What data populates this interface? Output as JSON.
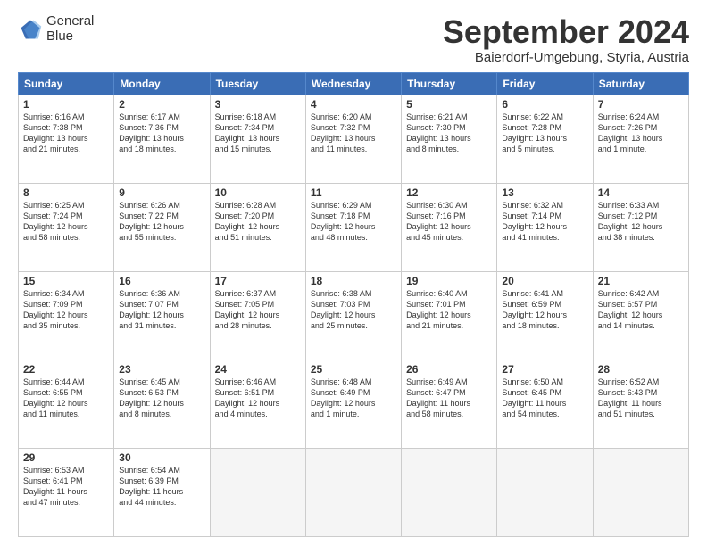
{
  "header": {
    "logo_line1": "General",
    "logo_line2": "Blue",
    "month": "September 2024",
    "location": "Baierdorf-Umgebung, Styria, Austria"
  },
  "weekdays": [
    "Sunday",
    "Monday",
    "Tuesday",
    "Wednesday",
    "Thursday",
    "Friday",
    "Saturday"
  ],
  "weeks": [
    [
      {
        "day": "1",
        "lines": [
          "Sunrise: 6:16 AM",
          "Sunset: 7:38 PM",
          "Daylight: 13 hours",
          "and 21 minutes."
        ]
      },
      {
        "day": "2",
        "lines": [
          "Sunrise: 6:17 AM",
          "Sunset: 7:36 PM",
          "Daylight: 13 hours",
          "and 18 minutes."
        ]
      },
      {
        "day": "3",
        "lines": [
          "Sunrise: 6:18 AM",
          "Sunset: 7:34 PM",
          "Daylight: 13 hours",
          "and 15 minutes."
        ]
      },
      {
        "day": "4",
        "lines": [
          "Sunrise: 6:20 AM",
          "Sunset: 7:32 PM",
          "Daylight: 13 hours",
          "and 11 minutes."
        ]
      },
      {
        "day": "5",
        "lines": [
          "Sunrise: 6:21 AM",
          "Sunset: 7:30 PM",
          "Daylight: 13 hours",
          "and 8 minutes."
        ]
      },
      {
        "day": "6",
        "lines": [
          "Sunrise: 6:22 AM",
          "Sunset: 7:28 PM",
          "Daylight: 13 hours",
          "and 5 minutes."
        ]
      },
      {
        "day": "7",
        "lines": [
          "Sunrise: 6:24 AM",
          "Sunset: 7:26 PM",
          "Daylight: 13 hours",
          "and 1 minute."
        ]
      }
    ],
    [
      {
        "day": "8",
        "lines": [
          "Sunrise: 6:25 AM",
          "Sunset: 7:24 PM",
          "Daylight: 12 hours",
          "and 58 minutes."
        ]
      },
      {
        "day": "9",
        "lines": [
          "Sunrise: 6:26 AM",
          "Sunset: 7:22 PM",
          "Daylight: 12 hours",
          "and 55 minutes."
        ]
      },
      {
        "day": "10",
        "lines": [
          "Sunrise: 6:28 AM",
          "Sunset: 7:20 PM",
          "Daylight: 12 hours",
          "and 51 minutes."
        ]
      },
      {
        "day": "11",
        "lines": [
          "Sunrise: 6:29 AM",
          "Sunset: 7:18 PM",
          "Daylight: 12 hours",
          "and 48 minutes."
        ]
      },
      {
        "day": "12",
        "lines": [
          "Sunrise: 6:30 AM",
          "Sunset: 7:16 PM",
          "Daylight: 12 hours",
          "and 45 minutes."
        ]
      },
      {
        "day": "13",
        "lines": [
          "Sunrise: 6:32 AM",
          "Sunset: 7:14 PM",
          "Daylight: 12 hours",
          "and 41 minutes."
        ]
      },
      {
        "day": "14",
        "lines": [
          "Sunrise: 6:33 AM",
          "Sunset: 7:12 PM",
          "Daylight: 12 hours",
          "and 38 minutes."
        ]
      }
    ],
    [
      {
        "day": "15",
        "lines": [
          "Sunrise: 6:34 AM",
          "Sunset: 7:09 PM",
          "Daylight: 12 hours",
          "and 35 minutes."
        ]
      },
      {
        "day": "16",
        "lines": [
          "Sunrise: 6:36 AM",
          "Sunset: 7:07 PM",
          "Daylight: 12 hours",
          "and 31 minutes."
        ]
      },
      {
        "day": "17",
        "lines": [
          "Sunrise: 6:37 AM",
          "Sunset: 7:05 PM",
          "Daylight: 12 hours",
          "and 28 minutes."
        ]
      },
      {
        "day": "18",
        "lines": [
          "Sunrise: 6:38 AM",
          "Sunset: 7:03 PM",
          "Daylight: 12 hours",
          "and 25 minutes."
        ]
      },
      {
        "day": "19",
        "lines": [
          "Sunrise: 6:40 AM",
          "Sunset: 7:01 PM",
          "Daylight: 12 hours",
          "and 21 minutes."
        ]
      },
      {
        "day": "20",
        "lines": [
          "Sunrise: 6:41 AM",
          "Sunset: 6:59 PM",
          "Daylight: 12 hours",
          "and 18 minutes."
        ]
      },
      {
        "day": "21",
        "lines": [
          "Sunrise: 6:42 AM",
          "Sunset: 6:57 PM",
          "Daylight: 12 hours",
          "and 14 minutes."
        ]
      }
    ],
    [
      {
        "day": "22",
        "lines": [
          "Sunrise: 6:44 AM",
          "Sunset: 6:55 PM",
          "Daylight: 12 hours",
          "and 11 minutes."
        ]
      },
      {
        "day": "23",
        "lines": [
          "Sunrise: 6:45 AM",
          "Sunset: 6:53 PM",
          "Daylight: 12 hours",
          "and 8 minutes."
        ]
      },
      {
        "day": "24",
        "lines": [
          "Sunrise: 6:46 AM",
          "Sunset: 6:51 PM",
          "Daylight: 12 hours",
          "and 4 minutes."
        ]
      },
      {
        "day": "25",
        "lines": [
          "Sunrise: 6:48 AM",
          "Sunset: 6:49 PM",
          "Daylight: 12 hours",
          "and 1 minute."
        ]
      },
      {
        "day": "26",
        "lines": [
          "Sunrise: 6:49 AM",
          "Sunset: 6:47 PM",
          "Daylight: 11 hours",
          "and 58 minutes."
        ]
      },
      {
        "day": "27",
        "lines": [
          "Sunrise: 6:50 AM",
          "Sunset: 6:45 PM",
          "Daylight: 11 hours",
          "and 54 minutes."
        ]
      },
      {
        "day": "28",
        "lines": [
          "Sunrise: 6:52 AM",
          "Sunset: 6:43 PM",
          "Daylight: 11 hours",
          "and 51 minutes."
        ]
      }
    ],
    [
      {
        "day": "29",
        "lines": [
          "Sunrise: 6:53 AM",
          "Sunset: 6:41 PM",
          "Daylight: 11 hours",
          "and 47 minutes."
        ]
      },
      {
        "day": "30",
        "lines": [
          "Sunrise: 6:54 AM",
          "Sunset: 6:39 PM",
          "Daylight: 11 hours",
          "and 44 minutes."
        ]
      },
      {
        "day": "",
        "lines": []
      },
      {
        "day": "",
        "lines": []
      },
      {
        "day": "",
        "lines": []
      },
      {
        "day": "",
        "lines": []
      },
      {
        "day": "",
        "lines": []
      }
    ]
  ]
}
